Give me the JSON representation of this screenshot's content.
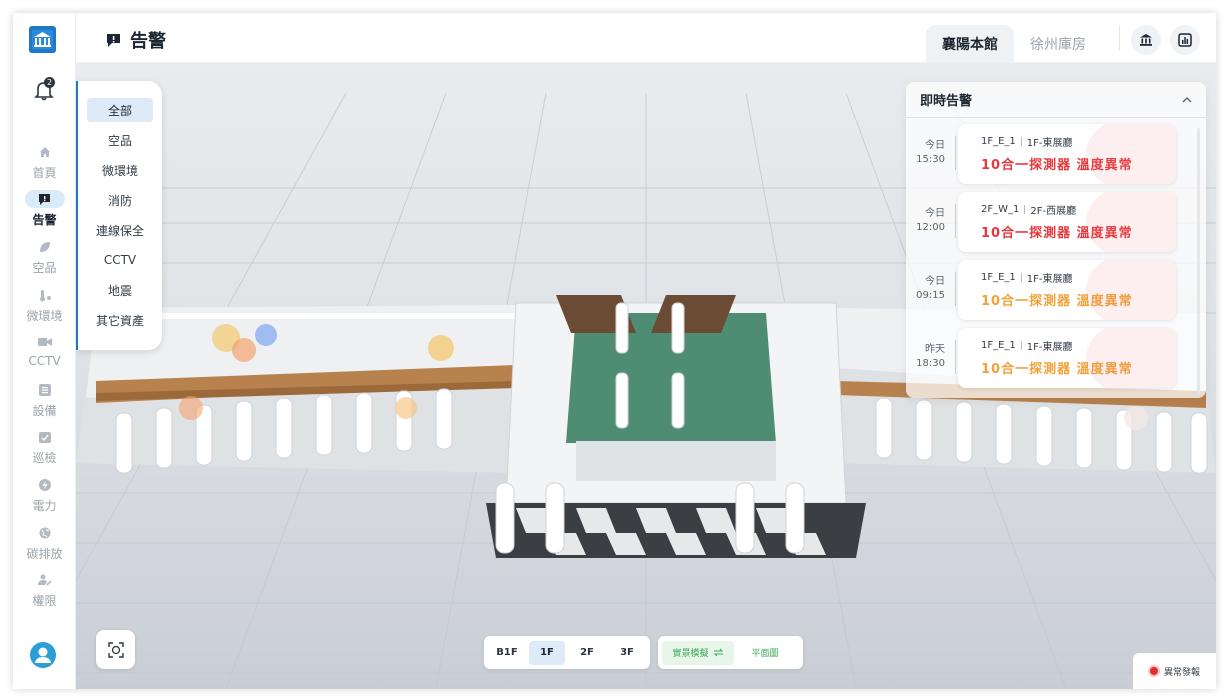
{
  "header": {
    "title": "告警"
  },
  "tabs": [
    {
      "label": "襄陽本館",
      "active": true
    },
    {
      "label": "徐州庫房",
      "active": false
    }
  ],
  "notifications": {
    "count": "2"
  },
  "nav": [
    {
      "label": "首頁",
      "icon": "home-icon"
    },
    {
      "label": "告警",
      "icon": "alert-icon",
      "active": true
    },
    {
      "label": "空品",
      "icon": "leaf-icon"
    },
    {
      "label": "微環境",
      "icon": "thermometer-icon"
    },
    {
      "label": "CCTV",
      "icon": "camera-icon"
    },
    {
      "label": "設備",
      "icon": "list-icon"
    },
    {
      "label": "巡檢",
      "icon": "checklist-icon"
    },
    {
      "label": "電力",
      "icon": "power-icon"
    },
    {
      "label": "碳排放",
      "icon": "globe-icon"
    },
    {
      "label": "權限",
      "icon": "user-key-icon"
    }
  ],
  "categories": [
    "全部",
    "空品",
    "微環境",
    "消防",
    "連線保全",
    "CCTV",
    "地震",
    "其它資產"
  ],
  "alerts": {
    "title": "即時告警",
    "items": [
      {
        "day": "今日",
        "time": "15:30",
        "code": "1F_E_1",
        "area": "1F-東展廳",
        "message": "10合一探測器 溫度異常",
        "color": "#e8383d"
      },
      {
        "day": "今日",
        "time": "12:00",
        "code": "2F_W_1",
        "area": "2F-西展廳",
        "message": "10合一探測器 溫度異常",
        "color": "#e8383d"
      },
      {
        "day": "今日",
        "time": "09:15",
        "code": "1F_E_1",
        "area": "1F-東展廳",
        "message": "10合一探測器 溫度異常",
        "color": "#f2a23a"
      },
      {
        "day": "昨天",
        "time": "18:30",
        "code": "1F_E_1",
        "area": "1F-東展廳",
        "message": "10合一探測器 溫度異常",
        "color": "#f2a23a"
      }
    ]
  },
  "floors": [
    {
      "label": "B1F",
      "active": false
    },
    {
      "label": "1F",
      "active": true
    },
    {
      "label": "2F",
      "active": false
    },
    {
      "label": "3F",
      "active": false
    }
  ],
  "views": {
    "live": "實景模擬",
    "plan": "平面圖"
  },
  "legend": {
    "label": "異常發報"
  },
  "colors": {
    "accent": "#1d78c7",
    "alert_red": "#e8383d",
    "alert_orange": "#f2a23a",
    "plan_green": "#3aaa54"
  }
}
